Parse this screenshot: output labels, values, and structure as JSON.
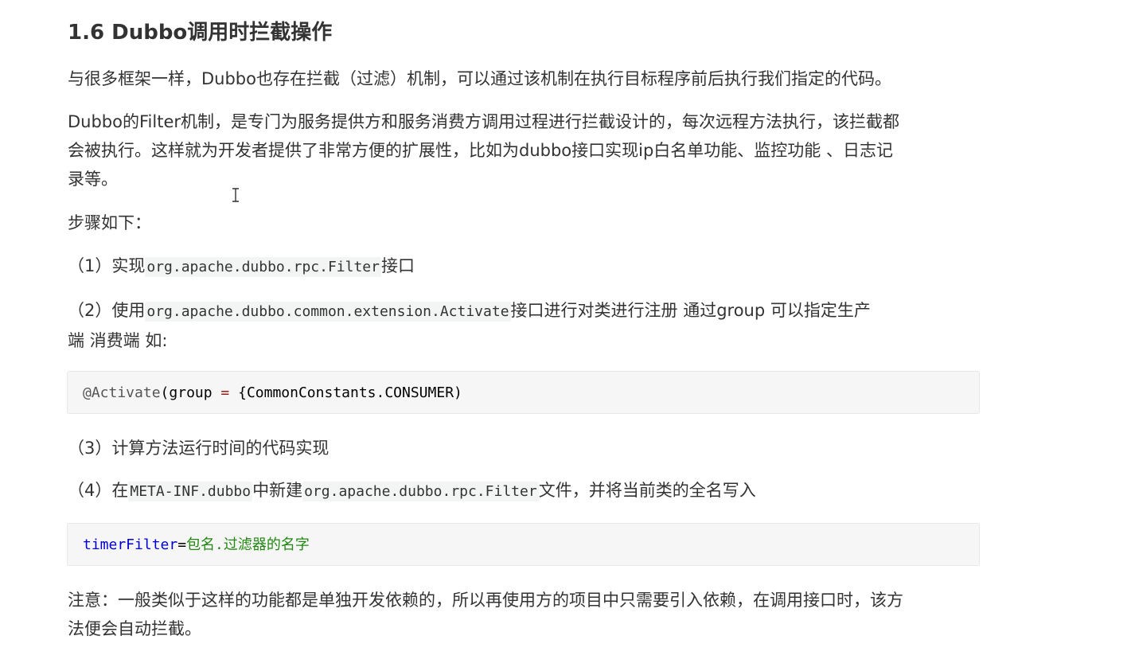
{
  "title": "1.6 Dubbo调用时拦截操作",
  "p1": "与很多框架一样，Dubbo也存在拦截（过滤）机制，可以通过该机制在执行目标程序前后执行我们指定的代码。",
  "p2": {
    "line1": "Dubbo的Filter机制，是专门为服务提供方和服务消费方调用过程进行拦截设计的，每次远程方法执行，该拦截都",
    "line2": "会被执行。这样就为开发者提供了非常方便的扩展性，比如为dubbo接口实现ip白名单功能、监控功能 、日志记",
    "line3": "录等。"
  },
  "steps_heading": "步骤如下：",
  "step1": {
    "prefix": "（1）实现",
    "code": "org.apache.dubbo.rpc.Filter",
    "suffix": "接口"
  },
  "step2": {
    "prefix": "（2）使用",
    "code": "org.apache.dubbo.common.extension.Activate",
    "suffix": "接口进行对类进行注册 通过group 可以指定生产",
    "line2": "端 消费端  如:"
  },
  "code_block_1": {
    "annotation": "@Activate",
    "open": "(",
    "ident": "group",
    "op": "=",
    "rest": "{CommonConstants.CONSUMER)"
  },
  "step3": "（3）计算方法运行时间的代码实现",
  "step4": {
    "prefix": "（4）在",
    "code1": "META-INF.dubbo",
    "middle": "中新建",
    "code2": "org.apache.dubbo.rpc.Filter",
    "suffix": "文件，并将当前类的全名写入"
  },
  "code_block_2": {
    "key": "timerFilter",
    "eq": "=",
    "value": "包名.过滤器的名字"
  },
  "note": {
    "line1": "注意：一般类似于这样的功能都是单独开发依赖的，所以再使用方的项目中只需要引入依赖，在调用接口时，该方",
    "line2": "法便会自动拦截。"
  },
  "colors": {
    "text": "#333333",
    "code_bg": "#f6f6f6",
    "code_key": "#0000cc",
    "code_string": "#228811",
    "code_operator": "#981a1a"
  }
}
